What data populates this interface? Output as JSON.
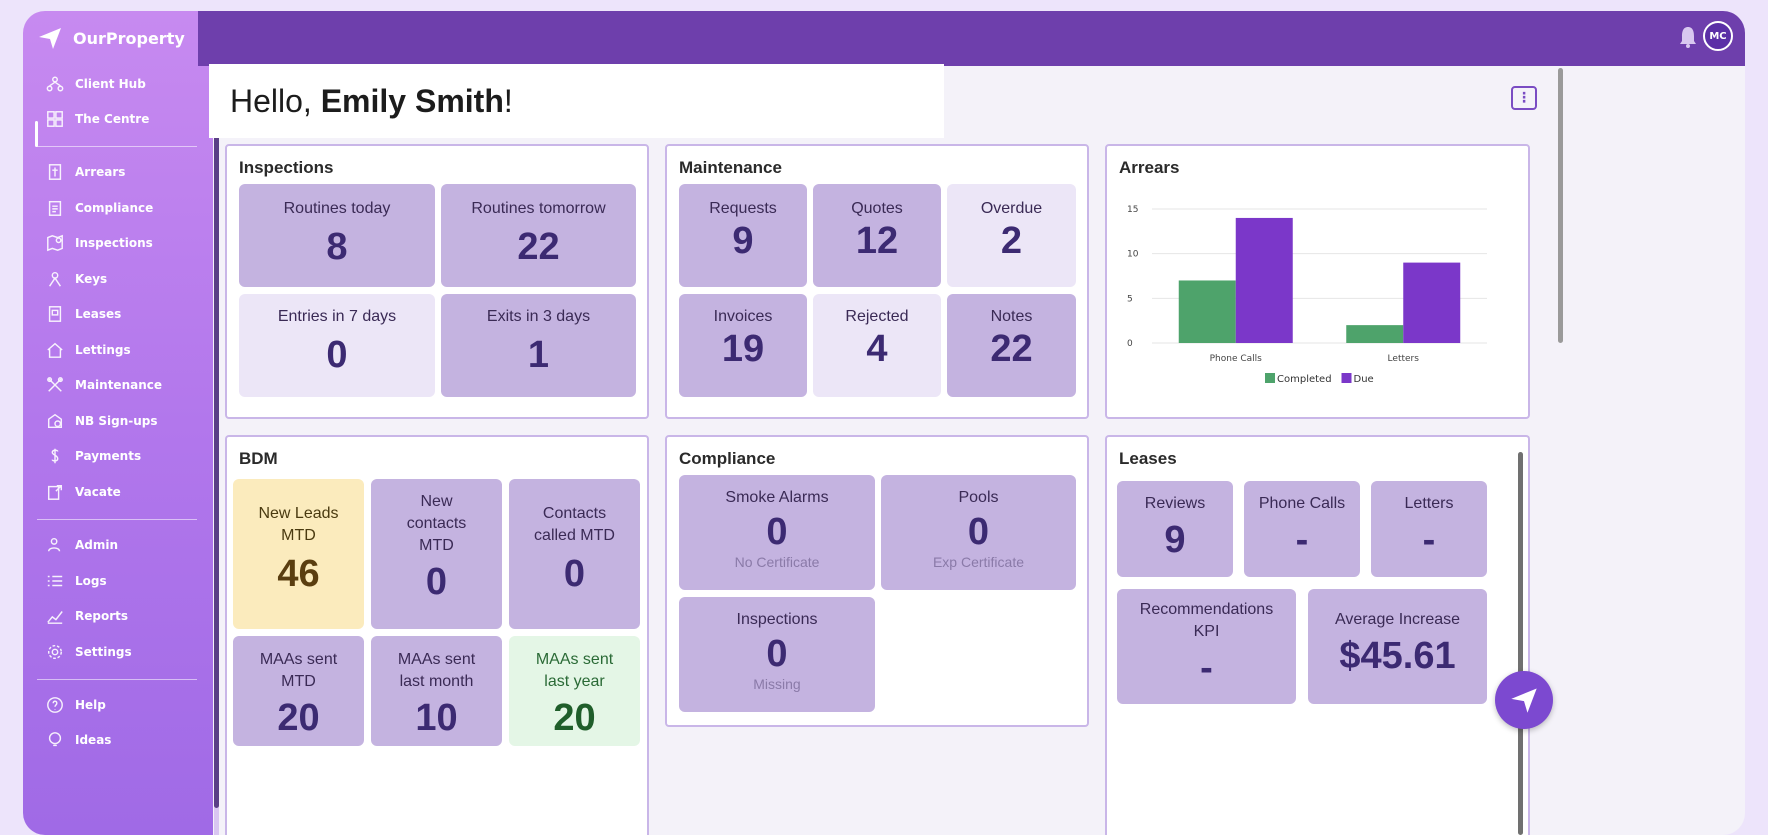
{
  "app": {
    "name": "OurProperty",
    "collapse": "‹"
  },
  "sidebar": {
    "items": [
      {
        "label": "Client Hub",
        "icon": "client-hub-icon"
      },
      {
        "label": "The Centre",
        "icon": "dashboard-grid-icon",
        "active": true
      },
      {
        "label": "Arrears",
        "icon": "arrears-icon"
      },
      {
        "label": "Compliance",
        "icon": "compliance-icon"
      },
      {
        "label": "Inspections",
        "icon": "inspections-icon"
      },
      {
        "label": "Keys",
        "icon": "keys-icon"
      },
      {
        "label": "Leases",
        "icon": "leases-icon"
      },
      {
        "label": "Lettings",
        "icon": "lettings-icon"
      },
      {
        "label": "Maintenance",
        "icon": "maintenance-icon"
      },
      {
        "label": "NB Sign-ups",
        "icon": "sign-ups-icon"
      },
      {
        "label": "Payments",
        "icon": "payments-icon"
      },
      {
        "label": "Vacate",
        "icon": "vacate-icon"
      },
      {
        "label": "Admin",
        "icon": "admin-icon"
      },
      {
        "label": "Logs",
        "icon": "logs-icon"
      },
      {
        "label": "Reports",
        "icon": "reports-icon"
      },
      {
        "label": "Settings",
        "icon": "settings-icon"
      },
      {
        "label": "Help",
        "icon": "help-icon"
      },
      {
        "label": "Ideas",
        "icon": "ideas-icon"
      }
    ]
  },
  "header": {
    "avatar_initials": "MC"
  },
  "greeting": {
    "prefix": "Hello, ",
    "name": "Emily Smith",
    "suffix": "!"
  },
  "inspections": {
    "title": "Inspections",
    "tiles": [
      {
        "label": "Routines today",
        "value": "8"
      },
      {
        "label": "Routines tomorrow",
        "value": "22"
      },
      {
        "label": "Entries in 7 days",
        "value": "0"
      },
      {
        "label": "Exits in 3 days",
        "value": "1"
      }
    ]
  },
  "maintenance": {
    "title": "Maintenance",
    "tiles": [
      {
        "label": "Requests",
        "value": "9"
      },
      {
        "label": "Quotes",
        "value": "12"
      },
      {
        "label": "Overdue",
        "value": "2"
      },
      {
        "label": "Invoices",
        "value": "19"
      },
      {
        "label": "Rejected",
        "value": "4"
      },
      {
        "label": "Notes",
        "value": "22"
      }
    ]
  },
  "arrears": {
    "title": "Arrears"
  },
  "chart_data": {
    "type": "bar",
    "title": "Arrears",
    "categories": [
      "Phone Calls",
      "Letters"
    ],
    "series": [
      {
        "name": "Completed",
        "values": [
          7,
          2
        ],
        "color": "#4ea36b"
      },
      {
        "name": "Due",
        "values": [
          14,
          9
        ],
        "color": "#7b37c9"
      }
    ],
    "yticks": [
      "0",
      "5",
      "10",
      "15"
    ],
    "ylim": [
      0,
      15
    ],
    "grid": true,
    "legend": "bottom"
  },
  "bdm": {
    "title": "BDM",
    "tiles": [
      {
        "label": "New Leads MTD",
        "value": "46"
      },
      {
        "label": "New contacts MTD",
        "value": "0"
      },
      {
        "label": "Contacts called MTD",
        "value": "0"
      },
      {
        "label": "MAAs sent MTD",
        "value": "20"
      },
      {
        "label": "MAAs sent last month",
        "value": "10"
      },
      {
        "label": "MAAs sent last year",
        "value": "20"
      }
    ]
  },
  "compliance": {
    "title": "Compliance",
    "tiles": [
      {
        "label": "Smoke Alarms",
        "value": "0",
        "sub": "No Certificate"
      },
      {
        "label": "Pools",
        "value": "0",
        "sub": "Exp Certificate"
      },
      {
        "label": "Inspections",
        "value": "0",
        "sub": "Missing"
      }
    ]
  },
  "leases": {
    "title": "Leases",
    "tiles": [
      {
        "label": "Reviews",
        "value": "9"
      },
      {
        "label": "Phone Calls",
        "value": "-"
      },
      {
        "label": "Letters",
        "value": "-"
      },
      {
        "label": "Recommendations KPI",
        "value": "-"
      },
      {
        "label": "Average Increase",
        "value": "$45.61"
      }
    ]
  }
}
